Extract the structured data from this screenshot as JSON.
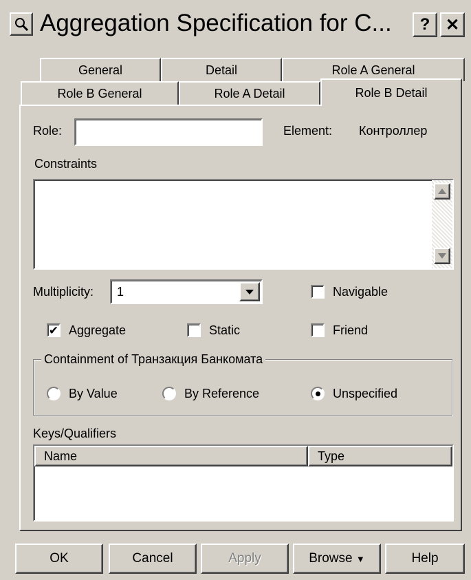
{
  "window": {
    "title": "Aggregation Specification for C...",
    "help_button": "?",
    "close_button": "✕",
    "title_icon": "magnifier-icon"
  },
  "tabs": {
    "row_top": [
      "General",
      "Detail",
      "Role A General"
    ],
    "row_bottom": [
      "Role B General",
      "Role A Detail",
      "Role B Detail"
    ],
    "active": "Role B Detail"
  },
  "role": {
    "label": "Role:",
    "value": "",
    "element_label": "Element:",
    "element_value": "Контроллер"
  },
  "constraints": {
    "label": "Constraints",
    "value": ""
  },
  "multiplicity": {
    "label": "Multiplicity:",
    "value": "1"
  },
  "checkboxes": {
    "navigable": {
      "label": "Navigable",
      "checked": false
    },
    "aggregate": {
      "label": "Aggregate",
      "checked": true,
      "mark": "✔"
    },
    "static": {
      "label": "Static",
      "checked": false
    },
    "friend": {
      "label": "Friend",
      "checked": false
    }
  },
  "containment": {
    "label": "Containment of Транзакция Банкомата",
    "options": {
      "by_value": {
        "label": "By Value",
        "selected": false
      },
      "by_reference": {
        "label": "By Reference",
        "selected": false
      },
      "unspecified": {
        "label": "Unspecified",
        "selected": true
      }
    }
  },
  "keys": {
    "label": "Keys/Qualifiers",
    "columns": [
      "Name",
      "Type"
    ],
    "rows": []
  },
  "buttons": {
    "ok": "OK",
    "cancel": "Cancel",
    "apply": "Apply",
    "browse": "Browse",
    "browse_arrow": "▼",
    "help": "Help"
  },
  "colors": {
    "face": "#d4d0c8",
    "disabled_text": "#808080"
  }
}
